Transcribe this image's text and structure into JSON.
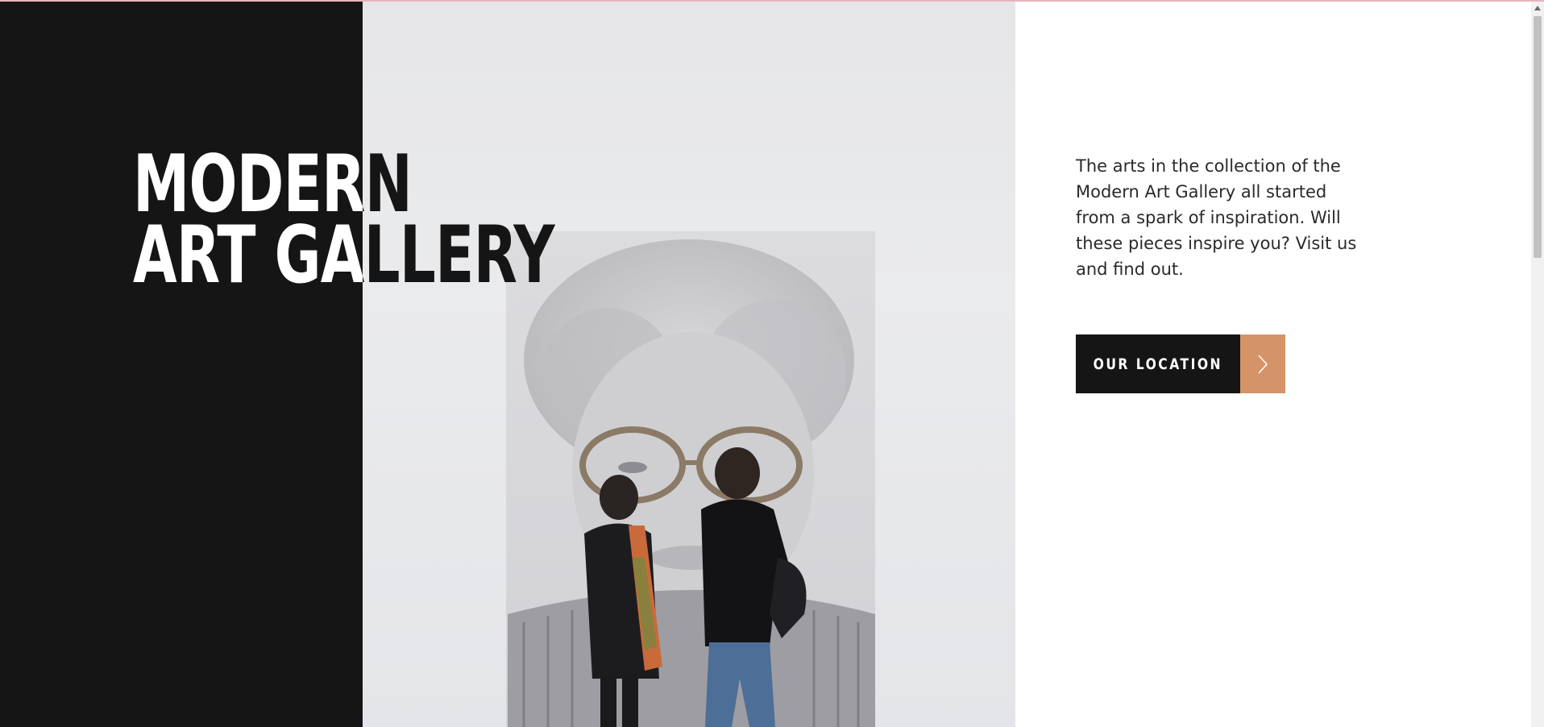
{
  "hero": {
    "title_line1": "MODERN",
    "title_line2": "ART GALLERY",
    "description": "The arts in the collection of the Modern Art Gallery all started from a spark of inspiration. Will these pieces inspire you? Visit us and find out.",
    "cta_label": "OUR LOCATION",
    "cta_icon": "chevron-right-icon",
    "photo_subject": "Two visitors looking at a large pencil portrait of an elderly woman"
  },
  "colors": {
    "dark": "#151515",
    "accent": "#d49468",
    "background": "#ffffff",
    "text": "#2a2a2a"
  }
}
